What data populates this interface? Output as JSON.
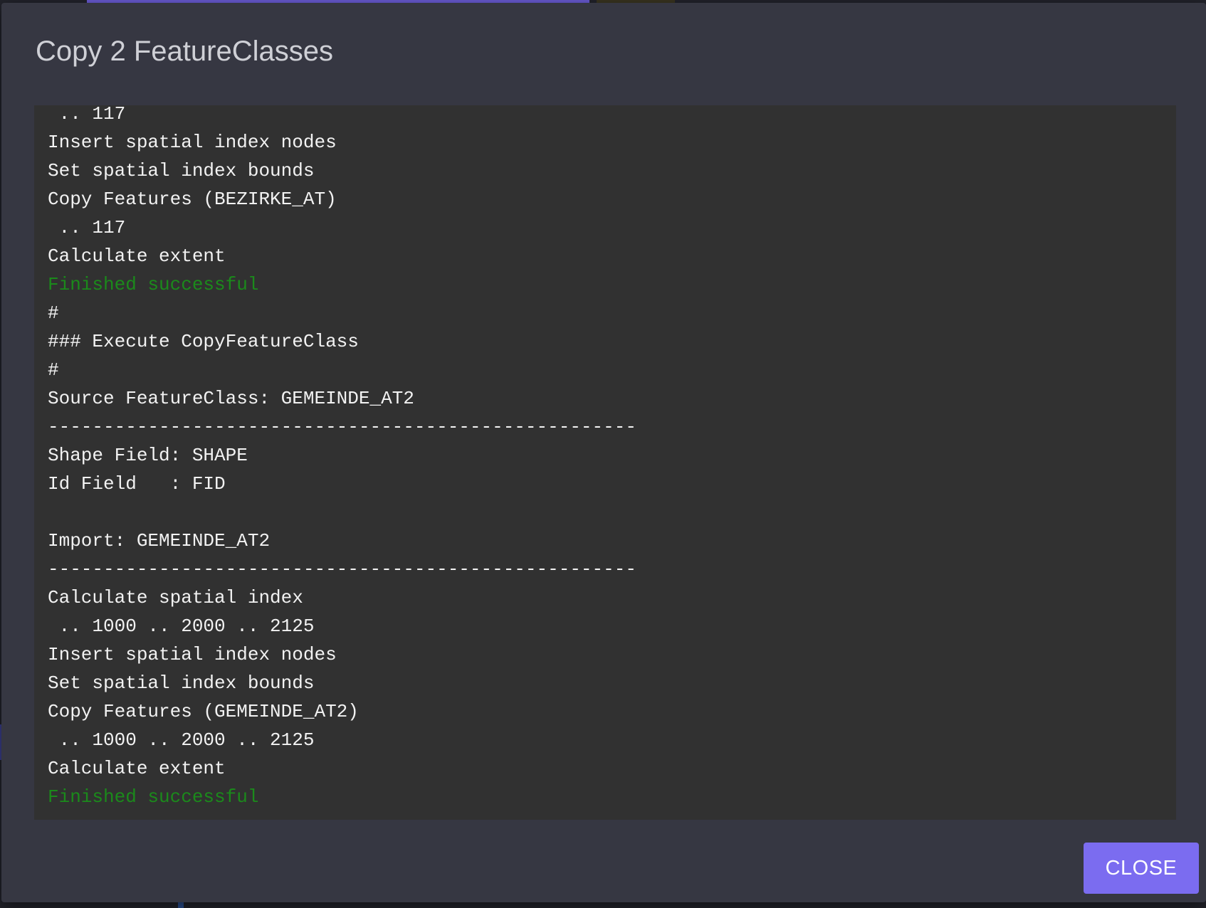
{
  "dialog": {
    "title": "Copy 2 FeatureClasses",
    "close_label": "CLOSE"
  },
  "log": {
    "lines": [
      {
        "text": " .. 117",
        "type": "normal"
      },
      {
        "text": "Insert spatial index nodes",
        "type": "normal"
      },
      {
        "text": "Set spatial index bounds",
        "type": "normal"
      },
      {
        "text": "Copy Features (BEZIRKE_AT)",
        "type": "normal"
      },
      {
        "text": " .. 117",
        "type": "normal"
      },
      {
        "text": "Calculate extent",
        "type": "normal"
      },
      {
        "text": "Finished successful",
        "type": "success"
      },
      {
        "text": "#",
        "type": "normal"
      },
      {
        "text": "### Execute CopyFeatureClass",
        "type": "normal"
      },
      {
        "text": "#",
        "type": "normal"
      },
      {
        "text": "Source FeatureClass: GEMEINDE_AT2",
        "type": "normal"
      },
      {
        "text": "-----------------------------------------------------",
        "type": "normal"
      },
      {
        "text": "Shape Field: SHAPE",
        "type": "normal"
      },
      {
        "text": "Id Field   : FID",
        "type": "normal"
      },
      {
        "text": "",
        "type": "normal"
      },
      {
        "text": "Import: GEMEINDE_AT2",
        "type": "normal"
      },
      {
        "text": "-----------------------------------------------------",
        "type": "normal"
      },
      {
        "text": "Calculate spatial index",
        "type": "normal"
      },
      {
        "text": " .. 1000 .. 2000 .. 2125",
        "type": "normal"
      },
      {
        "text": "Insert spatial index nodes",
        "type": "normal"
      },
      {
        "text": "Set spatial index bounds",
        "type": "normal"
      },
      {
        "text": "Copy Features (GEMEINDE_AT2)",
        "type": "normal"
      },
      {
        "text": " .. 1000 .. 2000 .. 2125",
        "type": "normal"
      },
      {
        "text": "Calculate extent",
        "type": "normal"
      },
      {
        "text": "Finished successful",
        "type": "success"
      }
    ]
  },
  "colors": {
    "success_text": "#1b8a1b",
    "button_accent": "#7b6cf0"
  }
}
